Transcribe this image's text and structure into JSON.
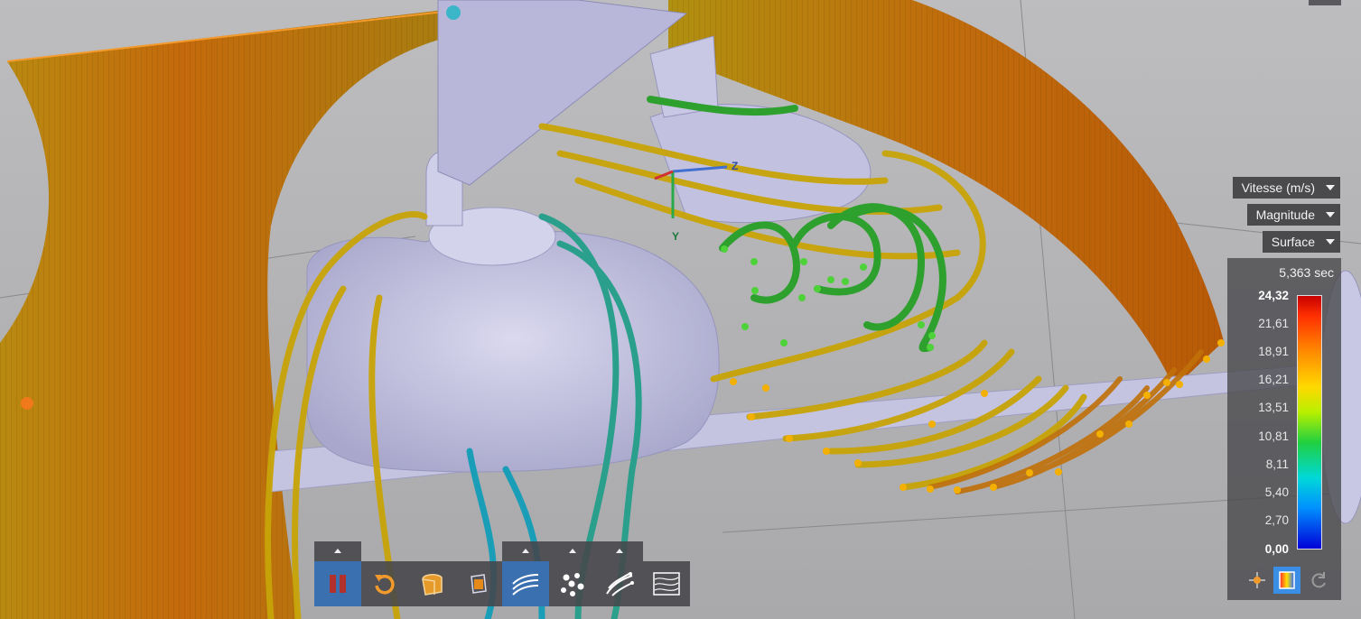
{
  "legend": {
    "quantity": "Vitesse (m/s)",
    "component": "Magnitude",
    "display": "Surface",
    "time": "5,363 sec",
    "max": "24,32",
    "min": "0,00",
    "ticks": [
      "21,61",
      "18,91",
      "16,21",
      "13,51",
      "10,81",
      "8,11",
      "5,40",
      "2,70"
    ]
  },
  "triad": {
    "z": "Z",
    "y": "Y"
  },
  "colors": {
    "panel": "#46464a",
    "active": "#3a6fb0",
    "accent": "#f39a2c",
    "flow_orange": "#c07a08",
    "flow_yellow": "#c8b400",
    "flow_green": "#2ea02e",
    "flow_teal": "#1aa0a0",
    "model": "#c9c8e4"
  },
  "toolbar": {
    "items": [
      {
        "name": "pause-icon",
        "active": true
      },
      {
        "name": "reset-icon",
        "active": false
      },
      {
        "name": "solid-view-icon",
        "active": false
      },
      {
        "name": "cutting-plane-icon",
        "active": false
      },
      {
        "name": "streamlines-icon",
        "active": true
      },
      {
        "name": "particles-icon",
        "active": false
      },
      {
        "name": "particle-traces-icon",
        "active": false
      },
      {
        "name": "surface-lic-icon",
        "active": false
      }
    ]
  },
  "legend_buttons": [
    "probe-icon",
    "color-legend-icon",
    "refresh-icon"
  ]
}
